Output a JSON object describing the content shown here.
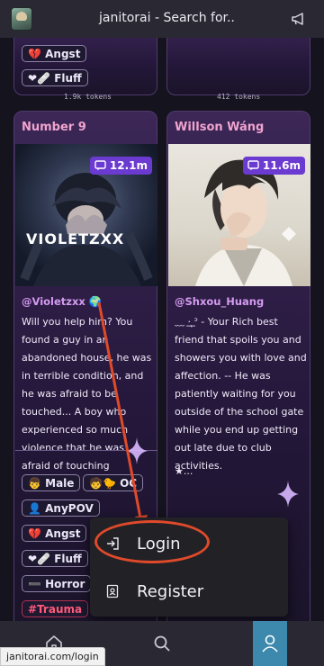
{
  "app": {
    "title": "janitorai - Search for..",
    "icons": {
      "app": "app-icon",
      "announce": "megaphone-icon"
    }
  },
  "top_cards": {
    "left": {
      "tags": [
        {
          "emoji": "💔",
          "label": "Angst"
        },
        {
          "emoji": "❤🩹",
          "label": "Fluff"
        }
      ],
      "tokens": "1.9k tokens"
    },
    "right": {
      "tokens": "412 tokens"
    }
  },
  "cards": [
    {
      "name": "Number 9",
      "chat_count": "12.1m",
      "watermark": "VIOLETZXX",
      "creator": "@Violetzxx 🌍",
      "description": "Will you help him? You found a guy in an abandoned house, he was in terrible condition, and he was afraid to be touched... A boy who experienced so much violence that he was afraid of touching people...",
      "tags": [
        {
          "emoji": "👦",
          "label": "Male"
        },
        {
          "emoji": "🧒🐤",
          "label": "OC"
        },
        {
          "emoji": "👤",
          "label": "AnyPOV"
        },
        {
          "emoji": "💔",
          "label": "Angst"
        },
        {
          "emoji": "❤🩹",
          "label": "Fluff"
        },
        {
          "emoji": "➖",
          "label": "Horror"
        },
        {
          "emoji": "",
          "label": "#Trauma"
        }
      ]
    },
    {
      "name": "Willson Wáng",
      "chat_count": "11.6m",
      "creator": "@Shxou_Huang",
      "description": "﹏ ·͟ ̟ᐣ - Your Rich best friend that spoils you and showers you with love and affection. -- He was patiently waiting for you outside of the school gate while you end up getting out late due to club activities.",
      "ellipsis": "★..."
    }
  ],
  "menu": {
    "items": [
      {
        "label": "Login",
        "icon": "login-icon"
      },
      {
        "label": "Register",
        "icon": "register-icon"
      }
    ]
  },
  "bottom_nav": {
    "icons": [
      "home-icon",
      "search-icon",
      "user-icon"
    ]
  },
  "status_bar": {
    "url": "janitorai.com/login"
  },
  "colors": {
    "accent": "#6b3ad0",
    "annotation": "#e04a2a",
    "profile_active": "#3d89ad",
    "name_pink": "#f0a4ce"
  }
}
